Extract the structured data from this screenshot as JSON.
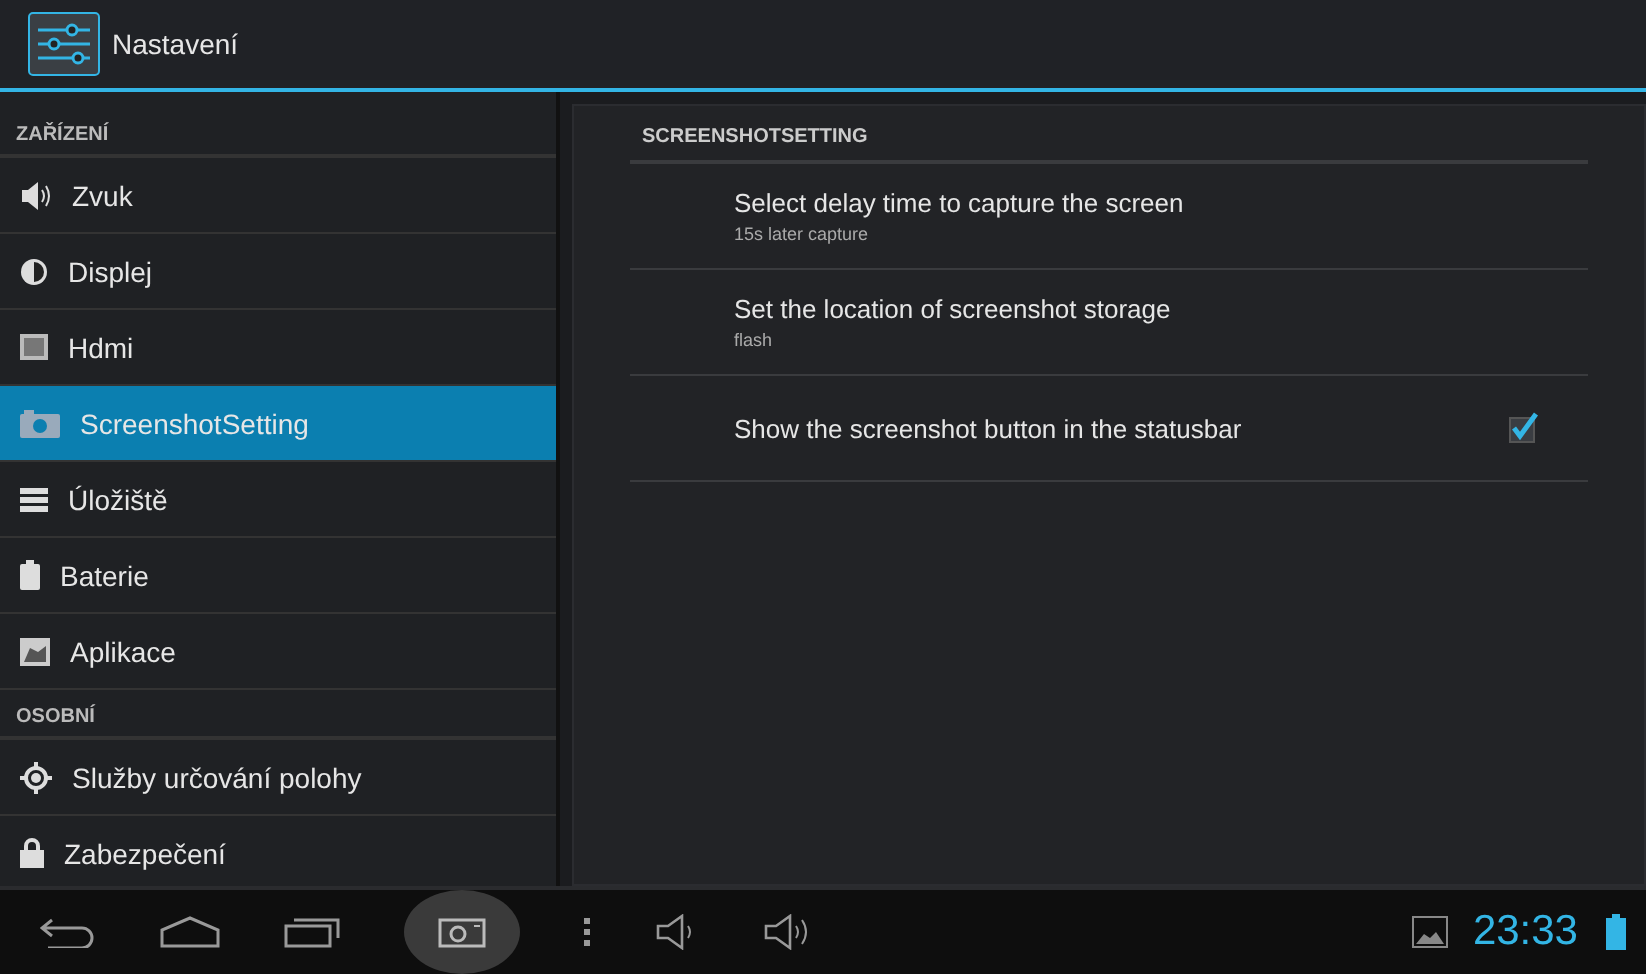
{
  "action_bar": {
    "title": "Nastavení"
  },
  "sidebar": {
    "sections": [
      {
        "header": "ZAŘÍZENÍ",
        "items": [
          {
            "label": "Zvuk",
            "kind": "speaker",
            "selected": false
          },
          {
            "label": "Displej",
            "kind": "brightness",
            "selected": false
          },
          {
            "label": "Hdmi",
            "kind": "screen",
            "selected": false
          },
          {
            "label": "ScreenshotSetting",
            "kind": "camera",
            "selected": true
          },
          {
            "label": "Úložiště",
            "kind": "storage",
            "selected": false
          },
          {
            "label": "Baterie",
            "kind": "battery",
            "selected": false
          },
          {
            "label": "Aplikace",
            "kind": "apps",
            "selected": false
          }
        ]
      },
      {
        "header": "OSOBNÍ",
        "items": [
          {
            "label": "Služby určování polohy",
            "kind": "location",
            "selected": false
          },
          {
            "label": "Zabezpečení",
            "kind": "lock",
            "selected": false
          }
        ]
      }
    ]
  },
  "detail": {
    "header": "SCREENSHOTSETTING",
    "prefs": [
      {
        "kind": "text",
        "title": "Select delay time to capture the screen",
        "summary": "15s later capture"
      },
      {
        "kind": "text",
        "title": "Set the location of screenshot storage",
        "summary": "flash"
      },
      {
        "kind": "checkbox",
        "title": "Show the screenshot button in the statusbar",
        "checked": true
      }
    ]
  },
  "status_bar": {
    "time": "23:33"
  }
}
